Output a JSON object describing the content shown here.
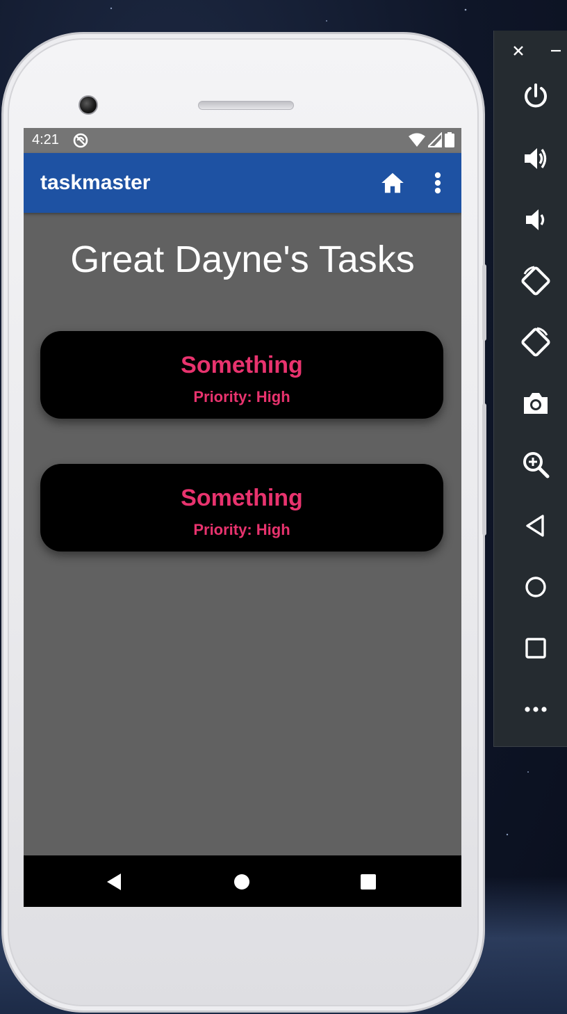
{
  "status_bar": {
    "time": "4:21",
    "icons": [
      "app-notification-icon",
      "wifi-icon",
      "signal-icon",
      "battery-icon"
    ]
  },
  "app_bar": {
    "title": "taskmaster",
    "color": "#1e52a3",
    "actions": [
      "home-icon",
      "more-vert-icon"
    ]
  },
  "main": {
    "heading": "Great Dayne's Tasks",
    "tasks": [
      {
        "title": "Something",
        "priority": "Priority: High"
      },
      {
        "title": "Something",
        "priority": "Priority: High"
      }
    ],
    "accent_color": "#e8336e"
  },
  "nav_bar": {
    "buttons": [
      "back-icon",
      "home-circle-icon",
      "recents-icon"
    ]
  },
  "emulator_panel": {
    "window_controls": [
      "close-icon",
      "minimize-icon"
    ],
    "tools": [
      "power-icon",
      "volume-up-icon",
      "volume-down-icon",
      "rotate-left-icon",
      "rotate-right-icon",
      "camera-icon",
      "zoom-icon",
      "back-icon",
      "home-icon",
      "overview-icon",
      "more-icon"
    ]
  }
}
